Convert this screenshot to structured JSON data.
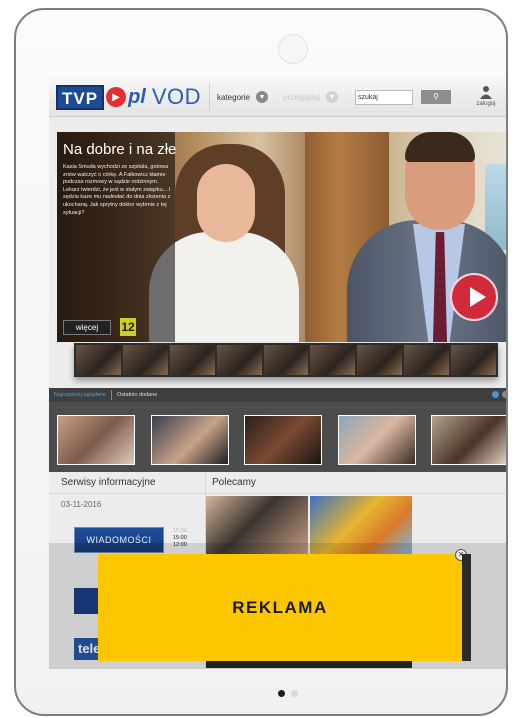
{
  "header": {
    "logo_tvp": "TVP",
    "logo_pl": "pl",
    "logo_vod": "VOD",
    "nav_categories": "kategorie",
    "nav_browse": "przeglądaj",
    "search_value": "szukaj",
    "search_button_icon": "search-icon",
    "login_label": "zaloguj"
  },
  "hero": {
    "title": "Na dobre i na złe",
    "description": "Kasia Smuda wychodzi ze szpitala, gotowa znów walczyć o córkę. A Falkowicz kłamie podczas rozmowy w sądzie rodzinnym. Lekarz twierdzi, że jest w stałym związku... I sędzia każe mu nadesłać do dnia złożenia z ukochaną. Jak sprytny doktor wybrnie z tej sytuacji?",
    "more_label": "więcej",
    "age_rating": "12"
  },
  "tabs": [
    {
      "label": "Najczęściej oglądane",
      "active": true
    },
    {
      "label": "Ostatnio dodane",
      "active": false
    }
  ],
  "info": {
    "news_heading": "Serwisy informacyjne",
    "date": "03-11-2016",
    "news_logo_text": "WIADOMOŚCI",
    "times": [
      "15:00",
      "12:00"
    ],
    "times_faded": "15:30",
    "logo3_text": "tele",
    "recommended_heading": "Polecamy"
  },
  "ad": {
    "text": "REKLAMA",
    "close_icon": "close-icon"
  },
  "colors": {
    "accent_blue": "#1e4a95",
    "play_red": "#d22a3d",
    "ad_yellow": "#fcc700"
  }
}
